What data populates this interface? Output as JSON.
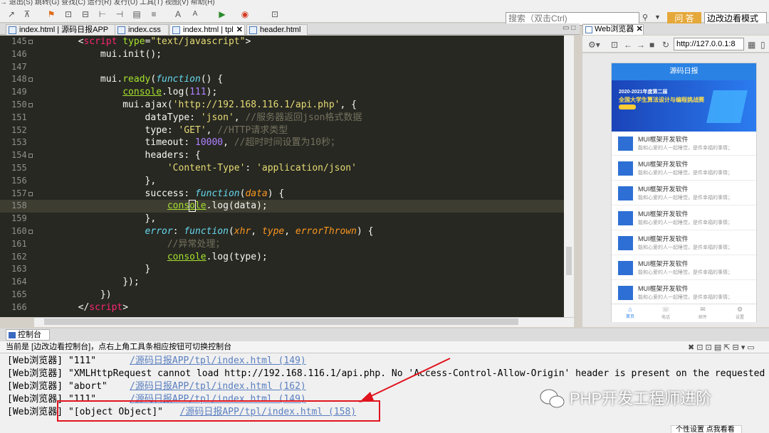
{
  "menu": {
    "fragment": "→ 退出(S)  跳转(G)  查找(C)  运行(R)  发行(U)  工具(T)  视图(V)  帮助(H)"
  },
  "toolbar": {
    "search_placeholder": "搜索（双击Ctrl)",
    "ask_label": "问 答",
    "mode_label": "边改边看模式"
  },
  "tabs": [
    {
      "label": "index.html | 源码日报APP",
      "active": false
    },
    {
      "label": "index.css",
      "active": false
    },
    {
      "label": "index.html | tpl",
      "active": true,
      "close": "✕"
    },
    {
      "label": "header.html",
      "active": false
    }
  ],
  "editor": {
    "lines": [
      {
        "n": "145",
        "fold": true
      },
      {
        "n": "146",
        "fold": false
      },
      {
        "n": "147",
        "fold": false
      },
      {
        "n": "148",
        "fold": true
      },
      {
        "n": "149",
        "fold": false
      },
      {
        "n": "150",
        "fold": true
      },
      {
        "n": "151",
        "fold": false
      },
      {
        "n": "152",
        "fold": false
      },
      {
        "n": "153",
        "fold": false
      },
      {
        "n": "154",
        "fold": true
      },
      {
        "n": "155",
        "fold": false
      },
      {
        "n": "156",
        "fold": false
      },
      {
        "n": "157",
        "fold": true
      },
      {
        "n": "158",
        "fold": false
      },
      {
        "n": "159",
        "fold": false
      },
      {
        "n": "160",
        "fold": true
      },
      {
        "n": "161",
        "fold": false
      },
      {
        "n": "162",
        "fold": false
      },
      {
        "n": "163",
        "fold": false
      },
      {
        "n": "164",
        "fold": false
      },
      {
        "n": "165",
        "fold": false
      },
      {
        "n": "166",
        "fold": false
      }
    ],
    "t": {
      "lt": "<",
      "script": "script",
      "type": "type",
      "eq": "=",
      "typeval": "\"text/javascript\"",
      "gt": ">",
      "mui_init": "mui.init();",
      "mui": "mui.",
      "ready": "ready",
      "lp": "(",
      "function": "function",
      "paren_brace": "() {",
      "console": "console",
      "log111": ".log(",
      "n111": "111",
      "rp_semi": ");",
      "ajax": "mui.ajax(",
      "url": "'http://192.168.116.1/api.php'",
      "comma_brace": ", {",
      "dataType": "dataType: ",
      "json": "'json'",
      "comma": ", ",
      "c_json": "//服务器返回json格式数据",
      "type_k": "type: ",
      "get": "'GET'",
      "c_get": "//HTTP请求类型",
      "timeout": "timeout: ",
      "n10000": "10000",
      "c_timeout": "//超时时间设置为10秒；",
      "headers": "headers: {",
      "ctype": "'Content-Type'",
      "colon": ": ",
      "appjson": "'application/json'",
      "close_comma": "},",
      "success": "success: ",
      "data": "data",
      "rp_brace": ") {",
      "cons_a": "cons",
      "cons_b": "o",
      "cons_c": "le",
      "logdata": ".log(data);",
      "error": "error",
      "colon2": ": ",
      "xhr": "xhr",
      "type_p": "type",
      "errorThrown": "errorThrown",
      "c_err": "//异常处理；",
      "logtype": ".log(type);",
      "close": "}",
      "close_paren": "});",
      "close_rp": "})",
      "end_script": "</"
    }
  },
  "browser": {
    "tab_label": "Web浏览器",
    "close": "✕",
    "address": "http://127.0.0.1:8",
    "phone": {
      "header": "源码日报",
      "banner_line1": "2020-2021年度第二届",
      "banner_line2": "全国大学生算法设计与编程挑战赛",
      "items": [
        {
          "title": "MUI框架开发软件",
          "sub": "能和心爱的人一起睡觉，是件幸福的事情；"
        },
        {
          "title": "MUI框架开发软件",
          "sub": "能和心爱的人一起睡觉，是件幸福的事情；"
        },
        {
          "title": "MUI框架开发软件",
          "sub": "能和心爱的人一起睡觉，是件幸福的事情；"
        },
        {
          "title": "MUI框架开发软件",
          "sub": "能和心爱的人一起睡觉，是件幸福的事情；"
        },
        {
          "title": "MUI框架开发软件",
          "sub": "能和心爱的人一起睡觉，是件幸福的事情；"
        },
        {
          "title": "MUI框架开发软件",
          "sub": "能和心爱的人一起睡觉，是件幸福的事情；"
        },
        {
          "title": "MUI框架开发软件",
          "sub": "能和心爱的人一起睡觉，是件幸福的事情；"
        }
      ],
      "footer": [
        "首页",
        "电话",
        "邮件",
        "设置"
      ]
    }
  },
  "console": {
    "tab_label": "控制台",
    "close": "✕",
    "info": "当前是 [边改边看控制台]，点右上角工具条相应按钮可切换控制台",
    "lines": [
      {
        "text": "[Web浏览器] \"111\"      ",
        "link": "/源码日报APP/tpl/index.html (149)"
      },
      {
        "text": "[Web浏览器] \"XMLHttpRequest cannot load http://192.168.116.1/api.php. No 'Access-Control-Allow-Origin' header is present on the requested",
        "link": ""
      },
      {
        "text": "[Web浏览器] \"abort\"    ",
        "link": "/源码日报APP/tpl/index.html (162)"
      },
      {
        "text": "[Web浏览器] \"111\"      ",
        "link": "/源码日报APP/tpl/index.html (149)"
      },
      {
        "text": "[Web浏览器] \"[object Object]\"   ",
        "link": "/源码日报APP/tpl/index.html (158)"
      }
    ]
  },
  "watermark": "PHP开发工程师进阶",
  "tooltip": "个性设置  点我看看",
  "colors": {
    "accent": "#e0141e",
    "link": "#5a7fc0",
    "editor_bg": "#272822"
  }
}
